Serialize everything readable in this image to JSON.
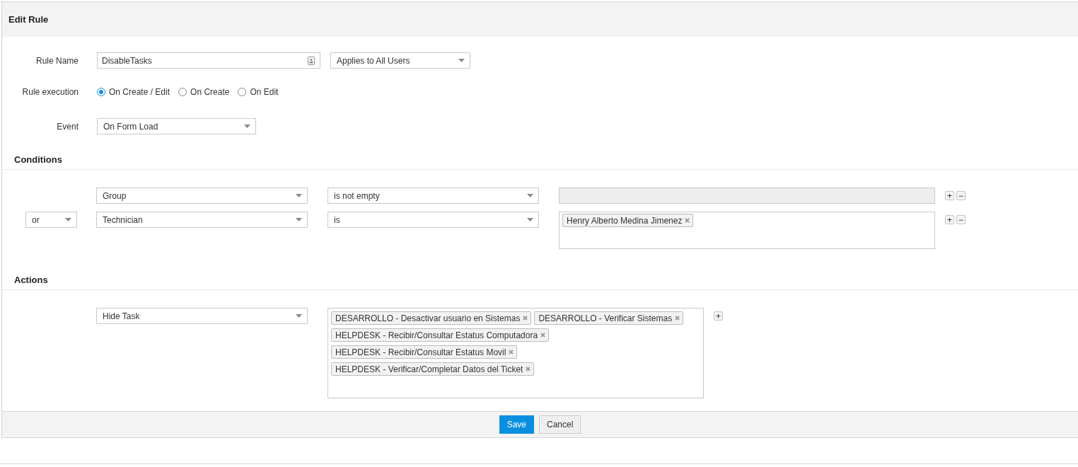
{
  "title": "Edit Rule",
  "rule_name": {
    "label": "Rule Name",
    "value": "DisableTasks",
    "applies_to": "Applies to All Users"
  },
  "rule_execution": {
    "label": "Rule execution",
    "options": [
      {
        "label": "On Create / Edit",
        "selected": true
      },
      {
        "label": "On Create",
        "selected": false
      },
      {
        "label": "On Edit",
        "selected": false
      }
    ]
  },
  "event": {
    "label": "Event",
    "value": "On Form Load"
  },
  "conditions": {
    "heading": "Conditions",
    "rows": [
      {
        "field": "Group",
        "operator": "is not empty",
        "disabled": true,
        "values": [],
        "add": "+",
        "remove": "−"
      },
      {
        "connector": "or",
        "field": "Technician",
        "operator": "is",
        "disabled": false,
        "values": [
          "Henry Alberto Medina Jimenez"
        ],
        "add": "+",
        "remove": "−"
      }
    ]
  },
  "actions": {
    "heading": "Actions",
    "rows": [
      {
        "action": "Hide Task",
        "values": [
          "DESARROLLO - Desactivar usuario en Sistemas",
          "DESARROLLO - Verificar Sistemas",
          "HELPDESK - Recibir/Consultar Estatus Computadora",
          "HELPDESK - Recibir/Consultar Estatus Movil",
          "HELPDESK - Verificar/Completar Datos del Ticket"
        ],
        "add": "+"
      }
    ]
  },
  "buttons": {
    "save": "Save",
    "cancel": "Cancel"
  }
}
